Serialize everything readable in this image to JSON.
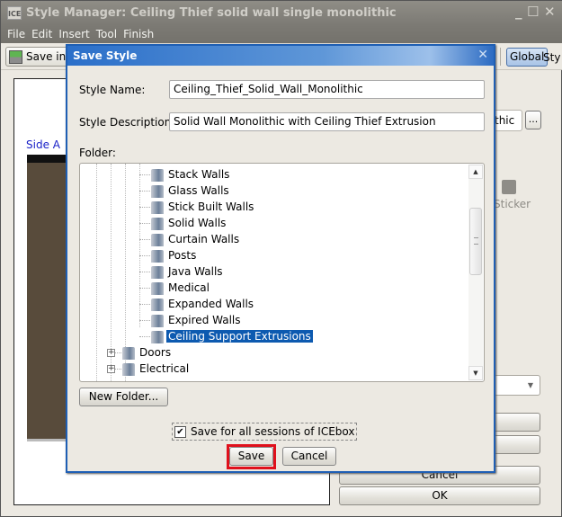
{
  "window": {
    "app_icon": "ICE",
    "title": "Style Manager: Ceiling Thief solid wall single monolithic",
    "controls": {
      "minimize": "_",
      "maximize": "☐",
      "close": "✕"
    }
  },
  "menubar": {
    "items": [
      "File",
      "Edit",
      "Insert",
      "Tool",
      "Finish"
    ]
  },
  "toolbar": {
    "save_in_label": "Save in",
    "global_label": "Global",
    "style_label_partial": "Sty"
  },
  "canvas": {
    "side_label": "Side A",
    "wall_color": "#584b3b"
  },
  "right_panel": {
    "field_partial": "thic",
    "browse_label": "...",
    "sticker_label": "Sticker",
    "cancel_label": "Cancel",
    "ok_label": "OK"
  },
  "dialog": {
    "title": "Save Style",
    "close": "✕",
    "style_name_label": "Style Name:",
    "style_name_value": "Ceiling_Thief_Solid_Wall_Monolithic",
    "style_desc_label": "Style Description:",
    "style_desc_value": "Solid Wall Monolithic with Ceiling Thief Extrusion",
    "folder_label": "Folder:",
    "tree": [
      {
        "label": "Stack Walls",
        "level": 3
      },
      {
        "label": "Glass Walls",
        "level": 3
      },
      {
        "label": "Stick Built Walls",
        "level": 3
      },
      {
        "label": "Solid Walls",
        "level": 3
      },
      {
        "label": "Curtain Walls",
        "level": 3
      },
      {
        "label": "Posts",
        "level": 3
      },
      {
        "label": "Java Walls",
        "level": 3
      },
      {
        "label": "Medical",
        "level": 3
      },
      {
        "label": "Expanded Walls",
        "level": 3
      },
      {
        "label": "Expired Walls",
        "level": 3
      },
      {
        "label": "Ceiling Support Extrusions",
        "level": 3,
        "selected": true
      },
      {
        "label": "Doors",
        "level": 2,
        "expandable": true
      },
      {
        "label": "Electrical",
        "level": 2,
        "expandable": true
      }
    ],
    "new_folder_label": "New Folder...",
    "save_all_sessions_label": "Save for all sessions of ICEbox",
    "save_all_sessions_checked": true,
    "save_label": "Save",
    "cancel_label": "Cancel",
    "highlight_color": "#e0101c",
    "selection_color": "#0d5ab0"
  }
}
